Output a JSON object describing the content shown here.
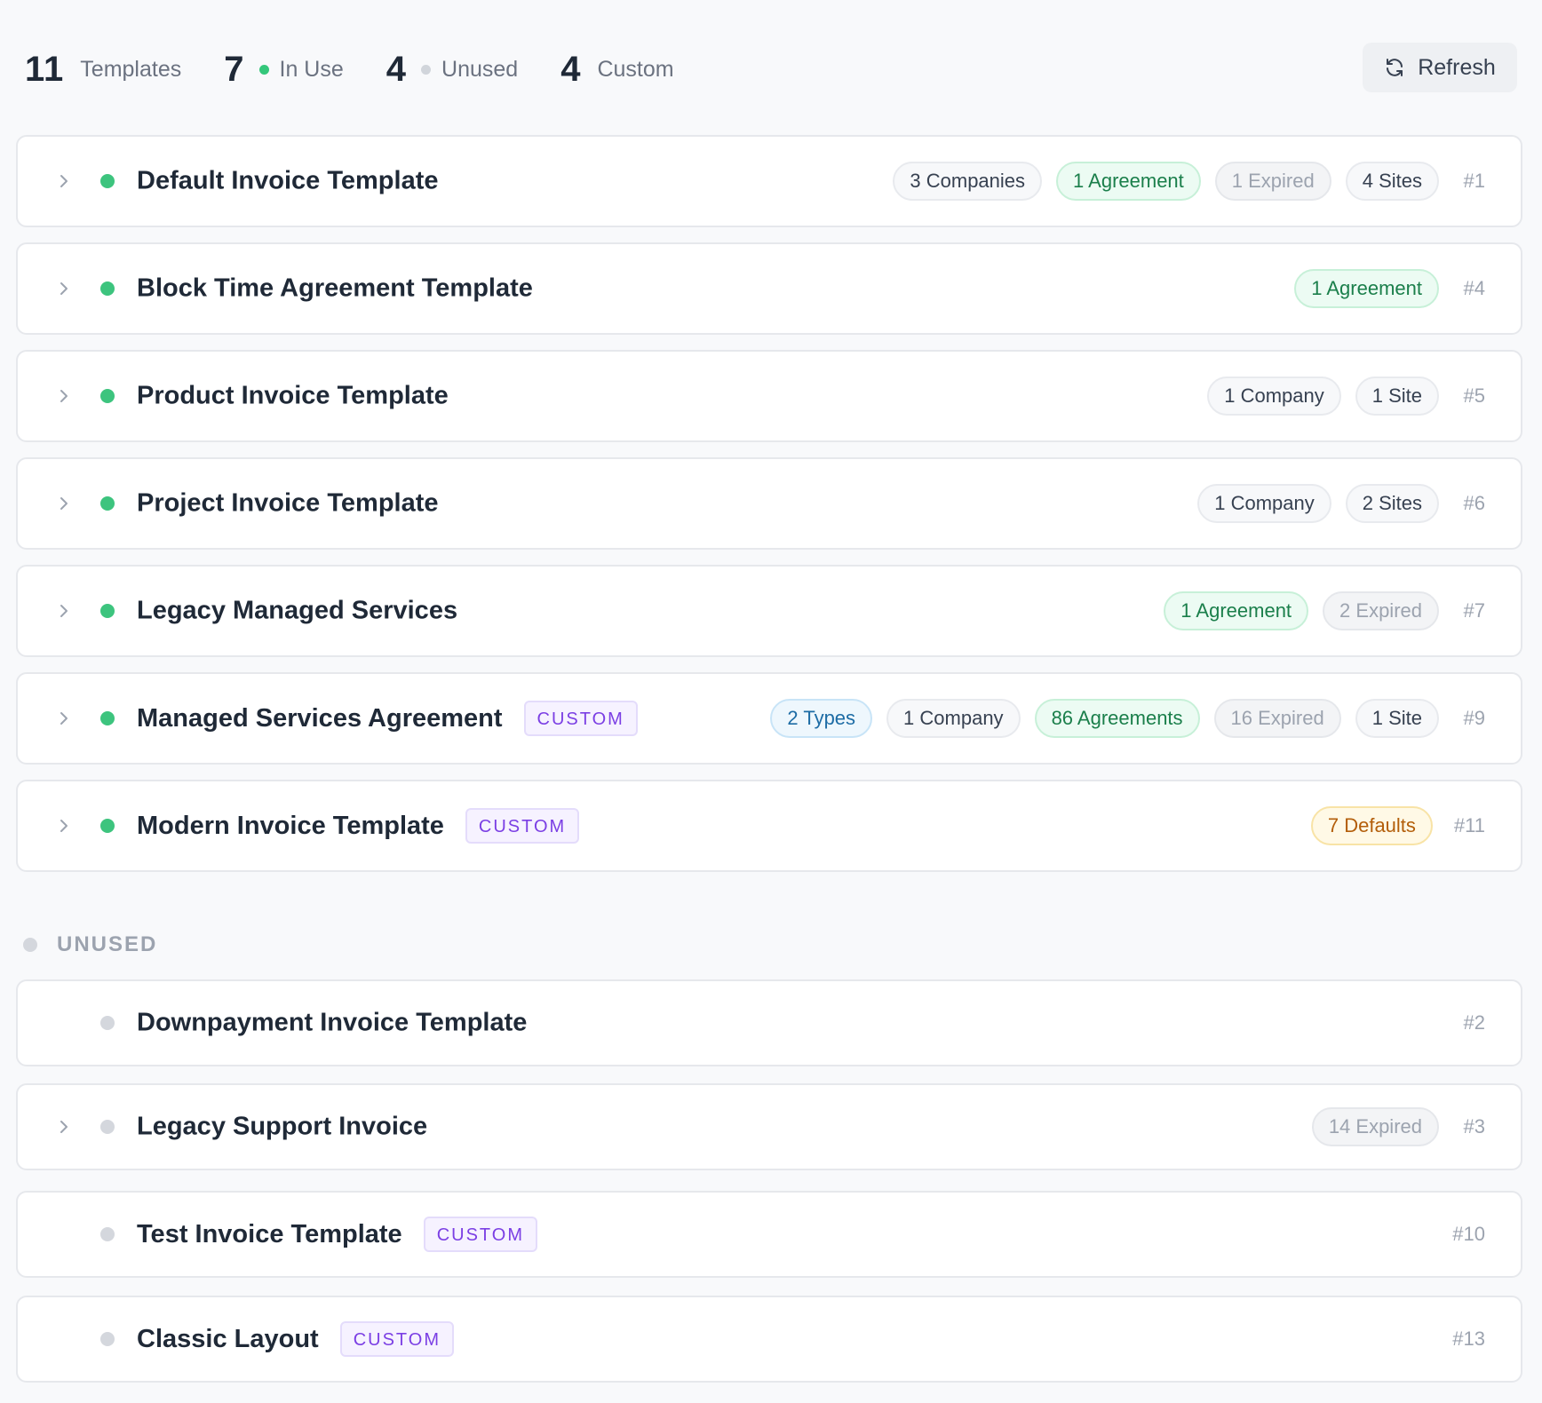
{
  "stats": {
    "templates": {
      "count": "11",
      "label": "Templates"
    },
    "in_use": {
      "count": "7",
      "label": "In Use",
      "dot_color": "#34c77b"
    },
    "unused": {
      "count": "4",
      "label": "Unused",
      "dot_color": "#d1d5db"
    },
    "custom": {
      "count": "4",
      "label": "Custom"
    }
  },
  "toolbar": {
    "refresh_label": "Refresh",
    "refresh_icon": "refresh-icon"
  },
  "custom_tag_label": "CUSTOM",
  "in_use_rows": [
    {
      "title": "Default Invoice Template",
      "id": "#1",
      "custom": false,
      "expandable": true,
      "pills": [
        {
          "text": "3 Companies",
          "kind": "gray"
        },
        {
          "text": "1 Agreement",
          "kind": "green"
        },
        {
          "text": "1 Expired",
          "kind": "expired"
        },
        {
          "text": "4 Sites",
          "kind": "gray"
        }
      ]
    },
    {
      "title": "Block Time Agreement Template",
      "id": "#4",
      "custom": false,
      "expandable": true,
      "pills": [
        {
          "text": "1 Agreement",
          "kind": "green"
        }
      ]
    },
    {
      "title": "Product Invoice Template",
      "id": "#5",
      "custom": false,
      "expandable": true,
      "pills": [
        {
          "text": "1 Company",
          "kind": "gray"
        },
        {
          "text": "1 Site",
          "kind": "gray"
        }
      ]
    },
    {
      "title": "Project Invoice Template",
      "id": "#6",
      "custom": false,
      "expandable": true,
      "pills": [
        {
          "text": "1 Company",
          "kind": "gray"
        },
        {
          "text": "2 Sites",
          "kind": "gray"
        }
      ]
    },
    {
      "title": "Legacy Managed Services",
      "id": "#7",
      "custom": false,
      "expandable": true,
      "pills": [
        {
          "text": "1 Agreement",
          "kind": "green"
        },
        {
          "text": "2 Expired",
          "kind": "expired"
        }
      ]
    },
    {
      "title": "Managed Services Agreement",
      "id": "#9",
      "custom": true,
      "expandable": true,
      "pills": [
        {
          "text": "2 Types",
          "kind": "blue"
        },
        {
          "text": "1 Company",
          "kind": "gray"
        },
        {
          "text": "86 Agreements",
          "kind": "green"
        },
        {
          "text": "16 Expired",
          "kind": "expired"
        },
        {
          "text": "1 Site",
          "kind": "gray"
        }
      ]
    },
    {
      "title": "Modern Invoice Template",
      "id": "#11",
      "custom": true,
      "expandable": true,
      "pills": [
        {
          "text": "7 Defaults",
          "kind": "yellow"
        }
      ]
    }
  ],
  "unused_section": {
    "label": "UNUSED"
  },
  "unused_rows": [
    {
      "title": "Downpayment Invoice Template",
      "id": "#2",
      "custom": false,
      "expandable": false,
      "pills": []
    },
    {
      "title": "Legacy Support Invoice",
      "id": "#3",
      "custom": false,
      "expandable": true,
      "pills": [
        {
          "text": "14 Expired",
          "kind": "expired"
        }
      ]
    },
    {
      "title": "Test Invoice Template",
      "id": "#10",
      "custom": true,
      "expandable": false,
      "pills": []
    },
    {
      "title": "Classic Layout",
      "id": "#13",
      "custom": true,
      "expandable": false,
      "pills": []
    }
  ],
  "colors": {
    "in_use_dot": "#3dc47e",
    "unused_dot": "#d4d7dd",
    "custom_tag": "#7b3fe4",
    "agreement_pill": "#1b7f4b",
    "types_pill": "#1d6ca5",
    "defaults_pill": "#b35e0a"
  }
}
